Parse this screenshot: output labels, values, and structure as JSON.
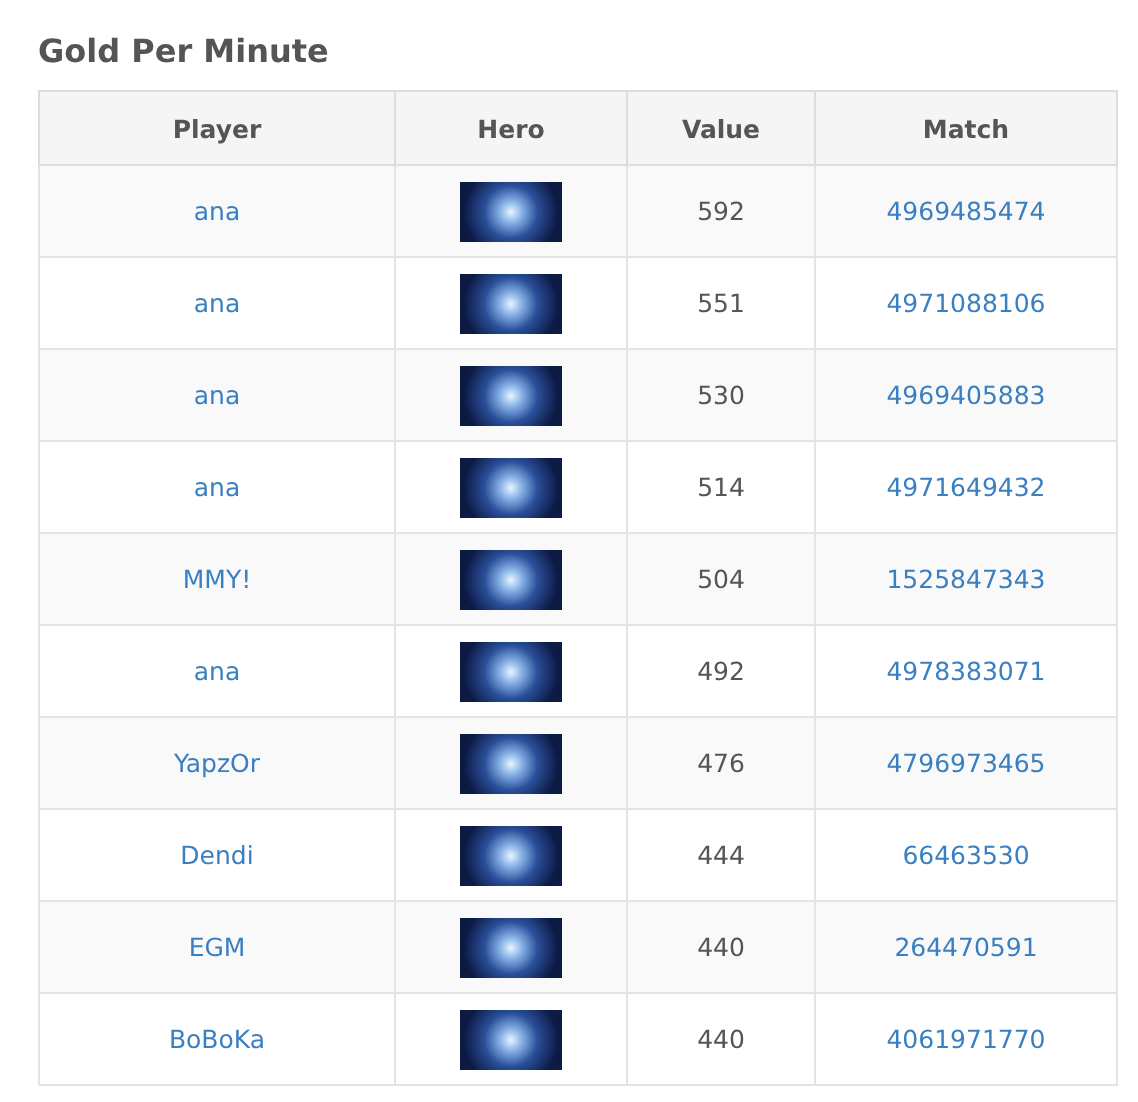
{
  "title": "Gold Per Minute",
  "table": {
    "columns": [
      "Player",
      "Hero",
      "Value",
      "Match"
    ],
    "rows": [
      {
        "player": "ana",
        "value": "592",
        "match": "4969485474"
      },
      {
        "player": "ana",
        "value": "551",
        "match": "4971088106"
      },
      {
        "player": "ana",
        "value": "530",
        "match": "4969405883"
      },
      {
        "player": "ana",
        "value": "514",
        "match": "4971649432"
      },
      {
        "player": "MMY!",
        "value": "504",
        "match": "1525847343"
      },
      {
        "player": "ana",
        "value": "492",
        "match": "4978383071"
      },
      {
        "player": "YapzOr",
        "value": "476",
        "match": "4796973465"
      },
      {
        "player": "Dendi",
        "value": "444",
        "match": "66463530"
      },
      {
        "player": "EGM",
        "value": "440",
        "match": "264470591"
      },
      {
        "player": "BoBoKa",
        "value": "440",
        "match": "4061971770"
      }
    ]
  }
}
